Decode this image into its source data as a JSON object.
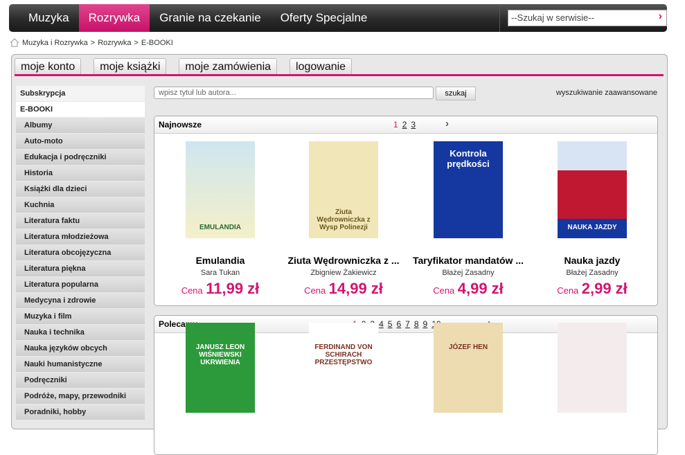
{
  "topnav": {
    "items": [
      "Muzyka",
      "Rozrywka",
      "Granie na czekanie",
      "Oferty Specjalne"
    ],
    "active": 1,
    "search_placeholder": "--Szukaj w serwisie--"
  },
  "breadcrumb": [
    "Muzyka i Rozrywka",
    ">",
    "Rozrywka",
    ">",
    "E-BOOKI"
  ],
  "tabs": [
    "moje konto",
    "moje książki",
    "moje zamówienia",
    "logowanie"
  ],
  "sidebar": [
    "Subskrypcja",
    "E-BOOKI",
    "Albumy",
    "Auto-moto",
    "Edukacja i podręczniki",
    "Historia",
    "Książki dla dzieci",
    "Kuchnia",
    "Literatura faktu",
    "Literatura młodzieżowa",
    "Literatura obcojęzyczna",
    "Literatura piękna",
    "Literatura popularna",
    "Medycyna i zdrowie",
    "Muzyka i film",
    "Nauka i technika",
    "Nauka języków obcych",
    "Nauki humanistyczne",
    "Podręczniki",
    "Podróże, mapy, przewodniki",
    "Poradniki, hobby"
  ],
  "search": {
    "placeholder": "wpisz tytuł lub autora...",
    "button": "szukaj",
    "advanced": "wyszukiwanie zaawansowane"
  },
  "newest": {
    "title": "Najnowsze",
    "pages": [
      "1",
      "2",
      "3"
    ],
    "next": "›",
    "products": [
      {
        "title": "Emulandia",
        "author": "Sara Tukan",
        "price_label": "Cena",
        "price": "11,99 zł",
        "cover_text": "EMULANDIA"
      },
      {
        "title": "Ziuta Wędrowniczka z ...",
        "author": "Zbigniew Żakiewicz",
        "price_label": "Cena",
        "price": "14,99 zł",
        "cover_text": "Ziuta Wędrowniczka z Wysp Polinezji"
      },
      {
        "title": "Taryfikator mandatów ...",
        "author": "Błażej Zasadny",
        "price_label": "Cena",
        "price": "4,99 zł",
        "cover_text": "Kontrola prędkości"
      },
      {
        "title": "Nauka jazdy",
        "author": "Błażej Zasadny",
        "price_label": "Cena",
        "price": "2,99 zł",
        "cover_text": "NAUKA JAZDY"
      }
    ]
  },
  "recommended": {
    "title": "Polecamy",
    "pages": [
      "1",
      "2",
      "3",
      "4",
      "5",
      "6",
      "7",
      "8",
      "9",
      "10"
    ],
    "next": "›",
    "covers": [
      "JANUSZ LEON WIŚNIEWSKI UKRWIENIA",
      "FERDINAND VON SCHIRACH PRZESTĘPSTWO",
      "JÓZEF HEN",
      "",
      ""
    ]
  }
}
